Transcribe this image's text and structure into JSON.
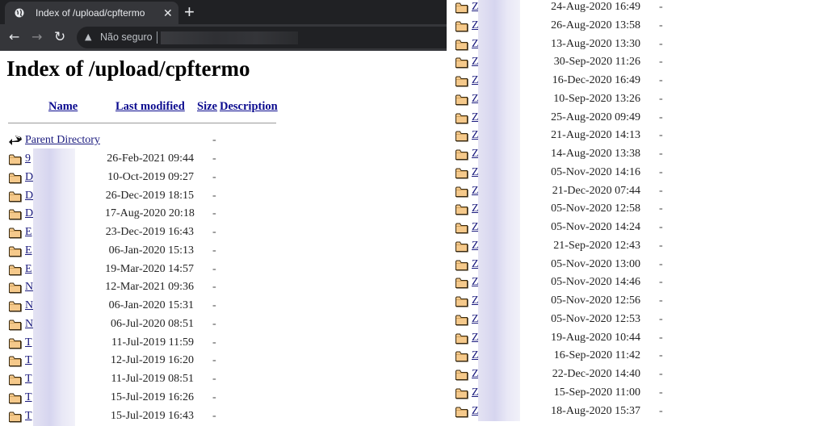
{
  "browser": {
    "tab_title": "Index of /upload/cpftermo",
    "tab_close": "✕",
    "new_tab": "+",
    "back": "←",
    "forward": "→",
    "reload": "↻",
    "security_warning_icon": "▲",
    "security_label": "Não seguro"
  },
  "page": {
    "heading": "Index of /upload/cpftermo",
    "columns": {
      "name": "Name",
      "last_modified": "Last modified",
      "size": "Size",
      "description": "Description"
    },
    "parent": {
      "label": "Parent Directory",
      "size": "-"
    },
    "entries_left": [
      {
        "name": "9",
        "modified": "26-Feb-2021 09:44",
        "size": "-"
      },
      {
        "name": "D",
        "modified": "10-Oct-2019 09:27",
        "size": "-"
      },
      {
        "name": "D",
        "modified": "26-Dec-2019 18:15",
        "size": "-"
      },
      {
        "name": "D",
        "modified": "17-Aug-2020 20:18",
        "size": "-"
      },
      {
        "name": "E",
        "modified": "23-Dec-2019 16:43",
        "size": "-"
      },
      {
        "name": "E",
        "modified": "06-Jan-2020 15:13",
        "size": "-"
      },
      {
        "name": "E",
        "modified": "19-Mar-2020 14:57",
        "size": "-"
      },
      {
        "name": "N",
        "modified": "12-Mar-2021 09:36",
        "size": "-"
      },
      {
        "name": "N",
        "modified": "06-Jan-2020 15:31",
        "size": "-"
      },
      {
        "name": "N",
        "modified": "06-Jul-2020 08:51",
        "size": "-"
      },
      {
        "name": "T",
        "modified": "11-Jul-2019 11:59",
        "size": "-"
      },
      {
        "name": "T",
        "modified": "12-Jul-2019 16:20",
        "size": "-"
      },
      {
        "name": "T",
        "modified": "11-Jul-2019 08:51",
        "size": "-"
      },
      {
        "name": "T",
        "modified": "15-Jul-2019 16:26",
        "size": "-"
      },
      {
        "name": "T",
        "modified": "15-Jul-2019 16:43",
        "size": "-"
      }
    ],
    "entries_right": [
      {
        "name": "Z",
        "modified": "24-Aug-2020 16:49",
        "size": "-"
      },
      {
        "name": "Z",
        "modified": "26-Aug-2020 13:58",
        "size": "-"
      },
      {
        "name": "Z",
        "modified": "13-Aug-2020 13:30",
        "size": "-"
      },
      {
        "name": "Z",
        "modified": "30-Sep-2020 11:26",
        "size": "-"
      },
      {
        "name": "Z",
        "modified": "16-Dec-2020 16:49",
        "size": "-"
      },
      {
        "name": "Z",
        "modified": "10-Sep-2020 13:26",
        "size": "-"
      },
      {
        "name": "Z",
        "modified": "25-Aug-2020 09:49",
        "size": "-"
      },
      {
        "name": "Z",
        "modified": "21-Aug-2020 14:13",
        "size": "-"
      },
      {
        "name": "Z",
        "modified": "14-Aug-2020 13:38",
        "size": "-"
      },
      {
        "name": "Z",
        "modified": "05-Nov-2020 14:16",
        "size": "-"
      },
      {
        "name": "Z",
        "modified": "21-Dec-2020 07:44",
        "size": "-"
      },
      {
        "name": "Z",
        "modified": "05-Nov-2020 12:58",
        "size": "-"
      },
      {
        "name": "Z",
        "modified": "05-Nov-2020 14:24",
        "size": "-"
      },
      {
        "name": "Z",
        "modified": "21-Sep-2020 12:43",
        "size": "-"
      },
      {
        "name": "Z",
        "modified": "05-Nov-2020 13:00",
        "size": "-"
      },
      {
        "name": "Z",
        "modified": "05-Nov-2020 14:46",
        "size": "-"
      },
      {
        "name": "Z",
        "modified": "05-Nov-2020 12:56",
        "size": "-"
      },
      {
        "name": "Z",
        "modified": "05-Nov-2020 12:53",
        "size": "-"
      },
      {
        "name": "Z",
        "modified": "19-Aug-2020 10:44",
        "size": "-"
      },
      {
        "name": "Z",
        "modified": "16-Sep-2020 11:42",
        "size": "-"
      },
      {
        "name": "Z",
        "modified": "22-Dec-2020 14:40",
        "size": "-"
      },
      {
        "name": "Z",
        "modified": "15-Sep-2020 11:00",
        "size": "-"
      },
      {
        "name": "Z",
        "modified": "18-Aug-2020 15:37",
        "size": "-"
      }
    ]
  },
  "colors": {
    "chrome_dark": "#202124",
    "chrome_tab": "#35363a",
    "link": "#1a1a7e",
    "folder_fill": "#f5c98b",
    "folder_outline": "#3a2a10"
  }
}
